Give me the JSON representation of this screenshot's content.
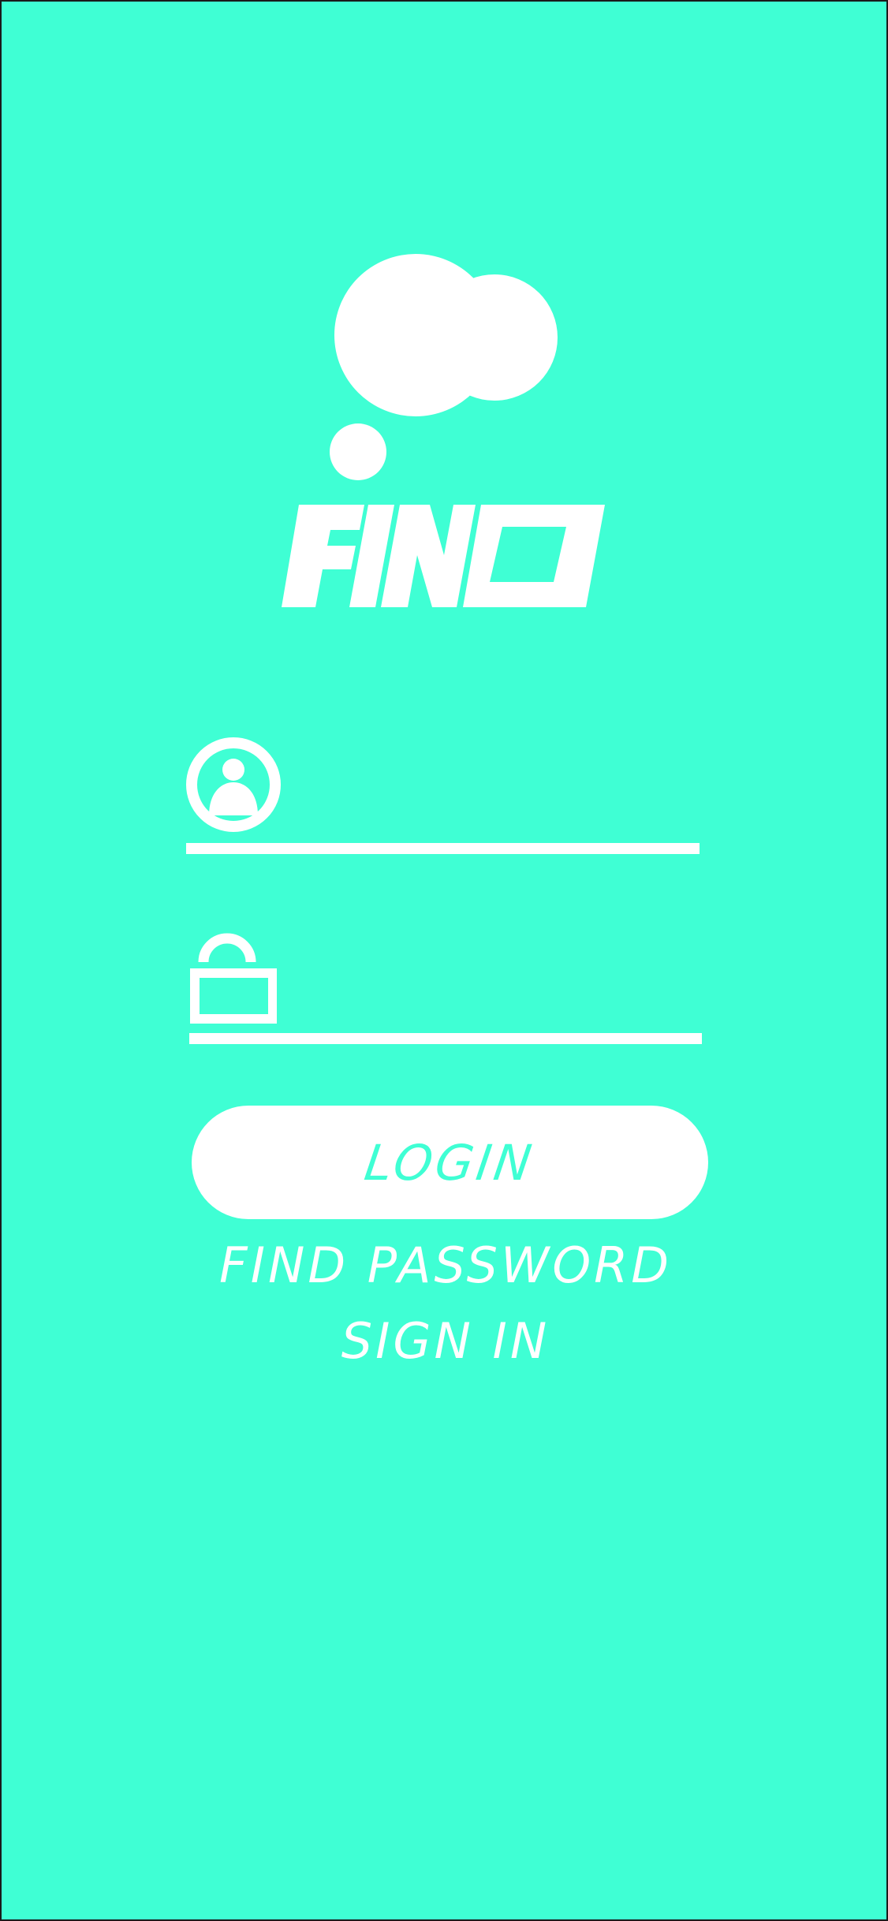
{
  "app": {
    "name": "FIND",
    "background_color": "#3fffd4",
    "foreground_color": "#ffffff"
  },
  "logo": {
    "wordmark": "FIND",
    "icon": "thought-bubble-icon"
  },
  "form": {
    "username": {
      "icon": "user-icon",
      "value": "",
      "placeholder": ""
    },
    "password": {
      "icon": "lock-icon",
      "value": "",
      "placeholder": ""
    },
    "login_label": "LOGIN"
  },
  "links": {
    "find_password": "FIND PASSWORD",
    "sign_in": "SIGN IN"
  }
}
